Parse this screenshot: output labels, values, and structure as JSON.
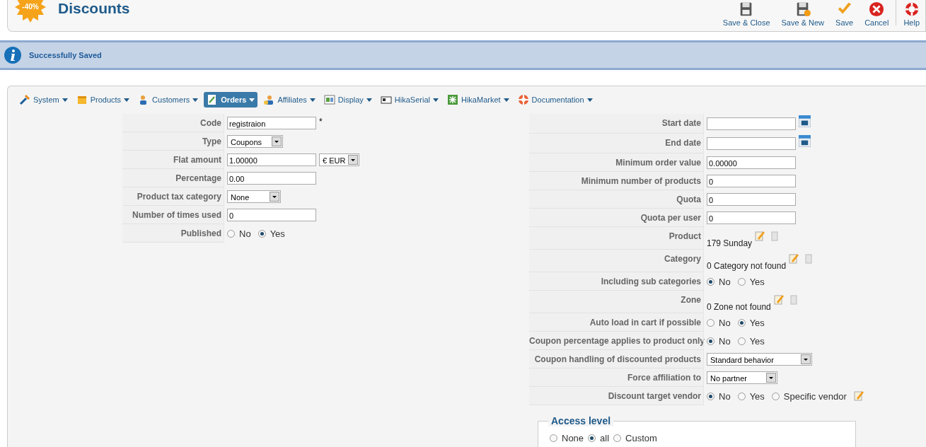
{
  "header": {
    "logo_text": "-40%",
    "title": "Discounts"
  },
  "toolbar": [
    {
      "kind": "save",
      "label": "Save & Close"
    },
    {
      "kind": "save-new",
      "label": "Save & New"
    },
    {
      "kind": "apply",
      "label": "Save"
    },
    {
      "kind": "cancel",
      "label": "Cancel"
    },
    {
      "kind": "help",
      "label": "Help"
    }
  ],
  "message": {
    "text": "Successfully Saved"
  },
  "menu": [
    {
      "kind": "tools",
      "label": "System",
      "selected": false
    },
    {
      "kind": "box",
      "label": "Products",
      "selected": false
    },
    {
      "kind": "users",
      "label": "Customers",
      "selected": false
    },
    {
      "kind": "orders",
      "label": "Orders",
      "selected": true
    },
    {
      "kind": "affiliates",
      "label": "Affiliates",
      "selected": false
    },
    {
      "kind": "display",
      "label": "Display",
      "selected": false
    },
    {
      "kind": "serial",
      "label": "HikaSerial",
      "selected": false
    },
    {
      "kind": "market",
      "label": "HikaMarket",
      "selected": false
    },
    {
      "kind": "docs",
      "label": "Documentation",
      "selected": false
    }
  ],
  "left_fields": [
    {
      "kind": "text",
      "label": "Code",
      "value": "registraion",
      "suffix": "*"
    },
    {
      "kind": "select",
      "label": "Type",
      "value": "Coupons"
    },
    {
      "kind": "text",
      "label": "Flat amount",
      "value": "1.00000",
      "currency": "€ EUR"
    },
    {
      "kind": "text",
      "label": "Percentage",
      "value": "0.00"
    },
    {
      "kind": "select",
      "label": "Product tax category",
      "value": "None"
    },
    {
      "kind": "text",
      "label": "Number of times used",
      "value": "0"
    },
    {
      "kind": "radio",
      "label": "Published",
      "options": [
        {
          "label": "No",
          "selected": false
        },
        {
          "label": "Yes",
          "selected": true
        }
      ]
    }
  ],
  "right_fields": [
    {
      "kind": "date",
      "label": "Start date"
    },
    {
      "kind": "date",
      "label": "End date"
    },
    {
      "kind": "text",
      "label": "Minimum order value",
      "value": "0.00000"
    },
    {
      "kind": "text",
      "label": "Minimum number of products",
      "value": "0"
    },
    {
      "kind": "text",
      "label": "Quota",
      "value": "0"
    },
    {
      "kind": "text",
      "label": "Quota per user",
      "value": "0"
    },
    {
      "kind": "link",
      "label": "Product",
      "value": "179 Sunday"
    },
    {
      "kind": "link",
      "label": "Category",
      "value": "0 Category not found"
    },
    {
      "kind": "radio",
      "label": "Including sub categories",
      "options": [
        {
          "label": "No",
          "selected": true
        },
        {
          "label": "Yes",
          "selected": false
        }
      ]
    },
    {
      "kind": "link",
      "label": "Zone",
      "value": "0 Zone not found"
    },
    {
      "kind": "radio",
      "label": "Auto load in cart if possible",
      "options": [
        {
          "label": "No",
          "selected": false
        },
        {
          "label": "Yes",
          "selected": true
        }
      ]
    },
    {
      "kind": "radio",
      "label": "Coupon percentage applies to product only",
      "options": [
        {
          "label": "No",
          "selected": true
        },
        {
          "label": "Yes",
          "selected": false
        }
      ]
    },
    {
      "kind": "select",
      "label": "Coupon handling of discounted products",
      "value": "Standard behavior"
    },
    {
      "kind": "select",
      "label": "Force affiliation to",
      "value": "No partner"
    },
    {
      "kind": "radio-edit",
      "label": "Discount target vendor",
      "options": [
        {
          "label": "No",
          "selected": true
        },
        {
          "label": "Yes",
          "selected": false
        },
        {
          "label": "Specific vendor",
          "selected": false
        }
      ]
    }
  ],
  "access": {
    "legend": "Access level",
    "options": [
      {
        "label": "None",
        "selected": false
      },
      {
        "label": "all",
        "selected": true
      },
      {
        "label": "Custom",
        "selected": false
      }
    ]
  }
}
